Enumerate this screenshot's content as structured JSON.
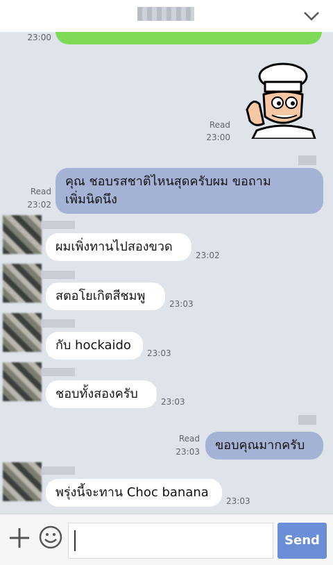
{
  "header": {
    "title": "",
    "chevron_icon": "chevron-down-icon"
  },
  "messages": [
    {
      "side": "out",
      "style": "green",
      "text": "",
      "read": "",
      "time": "23:00"
    },
    {
      "side": "out",
      "type": "sticker",
      "read": "Read",
      "time": "23:00"
    },
    {
      "side": "out",
      "text_line1": "คุณ   ชอบรสชาติไหนสุดครับผม ขอถาม",
      "text_line2": "เพิ่มนิดนึง",
      "read": "Read",
      "time": "23:02"
    },
    {
      "side": "in",
      "text": "ผมเพิ่งทานไปสองขวด",
      "time": "23:02"
    },
    {
      "side": "in",
      "text": "สตอโยเกิตสีชมพู",
      "time": "23:03"
    },
    {
      "side": "in",
      "text": "กับ hockaido",
      "time": "23:03"
    },
    {
      "side": "in",
      "text": "ชอบทั้งสองครับ",
      "time": "23:03"
    },
    {
      "side": "out",
      "text": "ขอบคุณมากครับ",
      "read": "Read",
      "time": "23:03"
    },
    {
      "side": "in",
      "text": "พรุ่งนี้จะทาน Choc banana",
      "time": "23:03"
    }
  ],
  "input": {
    "value": "",
    "send_label": "Send",
    "plus_icon": "plus-icon",
    "emoji_icon": "emoji-icon"
  },
  "colors": {
    "incoming": "#ffffff",
    "outgoing": "#a4b2d6",
    "green": "#7ed957",
    "send": "#6a8fd6"
  }
}
